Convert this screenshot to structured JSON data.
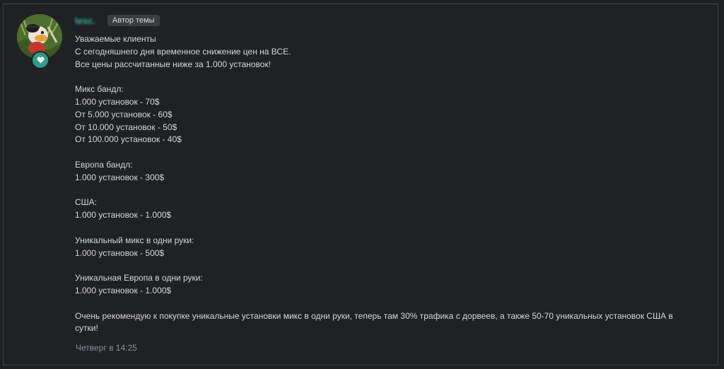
{
  "author": {
    "username": "lesc.",
    "badge": "Автор темы",
    "avatar_icon": "avatar-image",
    "status_icon": "heart-icon",
    "status_color": "#2e9c8a"
  },
  "message": {
    "paragraphs": [
      [
        "Уважаемые клиенты",
        "С сегодняшнего дня временное снижение цен на ВСЕ.",
        "Все цены рассчитанные ниже за 1.000 установок!"
      ],
      [
        "Микс бандл:",
        "1.000 установок - 70$",
        "От 5.000 установок - 60$",
        "От 10.000 установок - 50$",
        "От 100.000 установок - 40$"
      ],
      [
        "Европа бандл:",
        "1.000 установок - 300$"
      ],
      [
        "США:",
        "1.000 установок - 1.000$"
      ],
      [
        "Уникальный микс в одни руки:",
        "1.000 установок - 500$"
      ],
      [
        "Уникальная Европа в одни руки:",
        "1.000 установок - 1.000$"
      ],
      [
        "Очень рекомендую к покупке уникальные установки микс в одни руки, теперь там 30% трафика с дорвеев, а также 50-70 уникальных установок США в сутки!"
      ]
    ]
  },
  "date": "Четверг в 14:25"
}
